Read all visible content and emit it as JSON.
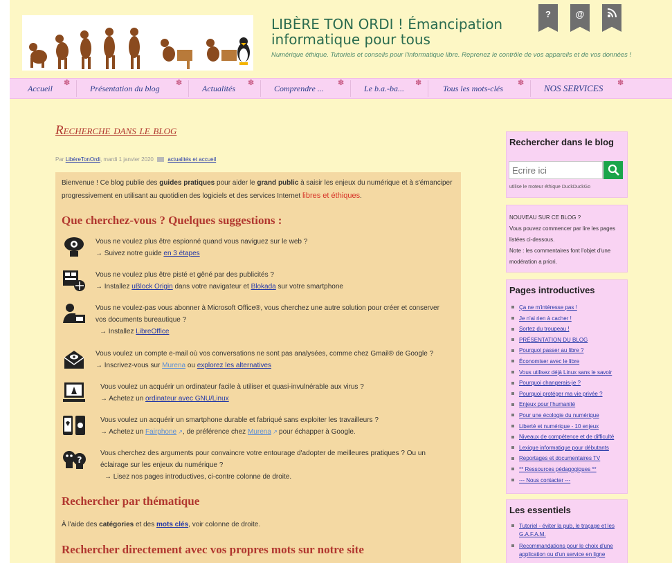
{
  "header": {
    "title": "LIBÈRE TON ORDI ! Émancipation informatique pour tous",
    "tagline": "Numérique éthique. Tutoriels et conseils pour l'informatique libre. Reprenez le contrôle de vos appareils et de vos données !",
    "buttons": [
      "?",
      "@",
      "RSS"
    ]
  },
  "nav": {
    "items": [
      "Accueil",
      "Présentation du blog",
      "Actualités",
      "Comprendre ...",
      "Le b.a.-ba...",
      "Tous les mots-clés",
      "NOS SERVICES"
    ]
  },
  "post": {
    "title": "Recherche dans le blog",
    "byline": {
      "prefix": "Par",
      "author": "LibèreTonOrdi",
      "date": ", mardi 1 janvier 2020",
      "category": "actualités et accueil"
    },
    "intro": {
      "p1": "Bienvenue ! Ce blog publie des ",
      "b1": "guides pratiques",
      "p2": " pour aider le ",
      "b2": "grand public",
      "p3": " à saisir les enjeux du numérique et à s'émanciper progressivement en utilisant au quotidien des logiciels et des services Internet ",
      "red": "libres et éthiques",
      "p4": "."
    },
    "h_suggestions": "Que cherchez-vous ? Quelques suggestions :",
    "suggestions": [
      {
        "q": "Vous ne voulez plus être espionné quand vous naviguez sur le web ?",
        "a_pre": "→ Suivez notre guide ",
        "link1": "en 3 étapes",
        "a_mid": "",
        "link2": "",
        "a_post": ""
      },
      {
        "q": "Vous ne voulez plus être pisté et gêné par des publicités ?",
        "a_pre": "→ Installez ",
        "link1": "uBlock Origin",
        "a_mid": " dans votre navigateur et ",
        "link2": "Blokada",
        "a_post": " sur votre smartphone"
      },
      {
        "q": "Vous ne voulez-pas vous abonner à Microsoft Office®, vous cherchez une autre solution pour créer et conserver vos documents bureautique ?",
        "a_pre": "→ Installez ",
        "link1": "LibreOffice",
        "a_mid": "",
        "link2": "",
        "a_post": ""
      },
      {
        "q": "Vous voulez un compte e-mail où vos conversations ne sont pas analysées, comme chez Gmail® de Google ?",
        "a_pre": "→ Inscrivez-vous sur ",
        "link1": "Murena",
        "a_mid": " ou ",
        "link2": "explorez les alternatives",
        "a_post": ""
      },
      {
        "q": "Vous voulez un acquérir un ordinateur facile à utiliser et quasi-invulnérable aux virus ?",
        "a_pre": "→ Achetez un ",
        "link1": "ordinateur avec GNU/Linux",
        "a_mid": "",
        "link2": "",
        "a_post": ""
      },
      {
        "q": "Vous voulez un acquérir un smartphone durable et fabriqué sans exploiter les travailleurs ?",
        "a_pre": "→ Achetez un ",
        "link1": "Fairphone",
        "a_mid": ", de préférence chez ",
        "link2": "Murena",
        "a_post": " pour échapper à Google."
      },
      {
        "q": "Vous cherchez des arguments pour convaincre votre entourage d'adopter de meilleures pratiques ? Ou un éclairage sur les enjeux du numérique ?",
        "a_pre": "→ Lisez nos pages introductives, ci-contre colonne de droite.",
        "link1": "",
        "a_mid": "",
        "link2": "",
        "a_post": ""
      }
    ],
    "h_theme": "Rechercher par thématique",
    "theme_text": {
      "p1": "À l'aide des ",
      "b1": "catégories",
      "p2": " et des ",
      "link": "mots clés",
      "p3": ", voir colonne de droite."
    },
    "h_search": "Rechercher directement avec vos propres mots sur notre site"
  },
  "sidebar": {
    "search": {
      "title": "Rechercher dans le blog",
      "placeholder": "Ecrire ici",
      "note": "utilise le moteur éthique DuckDuckGo"
    },
    "new_box": {
      "line1": "NOUVEAU SUR CE BLOG ?",
      "line2": "Vous pouvez commencer par lire les pages listées ci-dessous.",
      "line3": "Note : les commentaires font l'objet d'une modération a priori."
    },
    "intro_pages": {
      "title": "Pages introductives",
      "items": [
        "Ça ne m'intéresse pas !",
        "Je n'ai rien à cacher !",
        "Sortez du troupeau !",
        "PRÉSENTATION DU BLOG",
        "Pourquoi passer au libre ?",
        "Économiser avec le libre",
        "Vous utilisez déjà Linux sans le savoir",
        "Pourquoi changerais-je ?",
        "Pourquoi protéger ma vie privée ?",
        "Enjeux pour l'humanité",
        "Pour une écologie du numérique",
        "Liberté et numérique - 10 enjeux",
        "Niveaux de compétence et de difficulté",
        "Lexique informatique pour débutants",
        "Reportages et documentaires TV",
        "** Ressources pédagogiques **",
        "--- Nous contacter ---"
      ]
    },
    "essentials": {
      "title": "Les essentiels",
      "items": [
        "Tutoriel - éviter la pub, le traçage et les G.A.F.A.M.",
        "Recommandations pour le choix d'une application ou d'un service en ligne"
      ]
    }
  },
  "colors": {
    "background": "#fdf7c5",
    "nav": "#f9d3f3",
    "title_green": "#2a6b4f",
    "heading_red": "#b1372f",
    "link": "#2438a7",
    "article_bg": "#f4d9a3",
    "search_green": "#1aa54a"
  }
}
